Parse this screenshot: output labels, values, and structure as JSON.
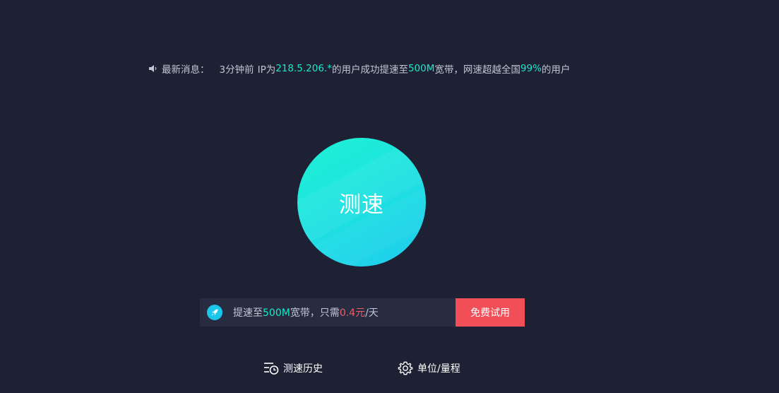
{
  "news": {
    "label": "最新消息：",
    "time": "3分钟前",
    "ip_prefix": "IP为",
    "ip": "218.5.206.*",
    "mid1": "的用户成功提速至",
    "speed": "500M",
    "mid2": "宽带，网速超越全国",
    "percent": "99%",
    "suffix": "的用户"
  },
  "main_button": {
    "label": "测速"
  },
  "promo": {
    "text_prefix": "提速至",
    "speed": "500M",
    "text_mid": "宽带，只需",
    "price": "0.4元",
    "unit": "/天",
    "button_label": "免费试用"
  },
  "footer": {
    "history_label": "测速历史",
    "settings_label": "单位/量程"
  },
  "colors": {
    "background": "#1e2133",
    "accent": "#1ee6c8",
    "price": "#f25b62",
    "trial_button": "#f24e58"
  }
}
